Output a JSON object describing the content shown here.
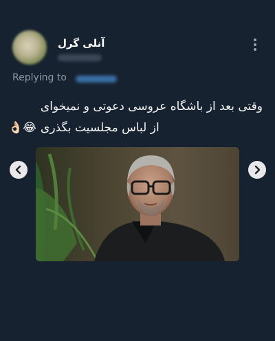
{
  "author": {
    "name": "آنلی گرل"
  },
  "reply": {
    "label": "Replying to"
  },
  "tweet": {
    "line1": "وقتی بعد از باشگاه عروسی دعوتی و نمیخوای",
    "line2": "از لباس مجلسیت بگذری",
    "emojis": "😂👌🏻"
  },
  "media": {
    "alt": ""
  },
  "icons": {
    "more": "more-vertical-icon",
    "prev": "chevron-left-icon",
    "next": "chevron-right-icon"
  },
  "colors": {
    "background": "#172230",
    "secondary_text": "#8b98a5",
    "nav_button": "#e8e8ea"
  }
}
